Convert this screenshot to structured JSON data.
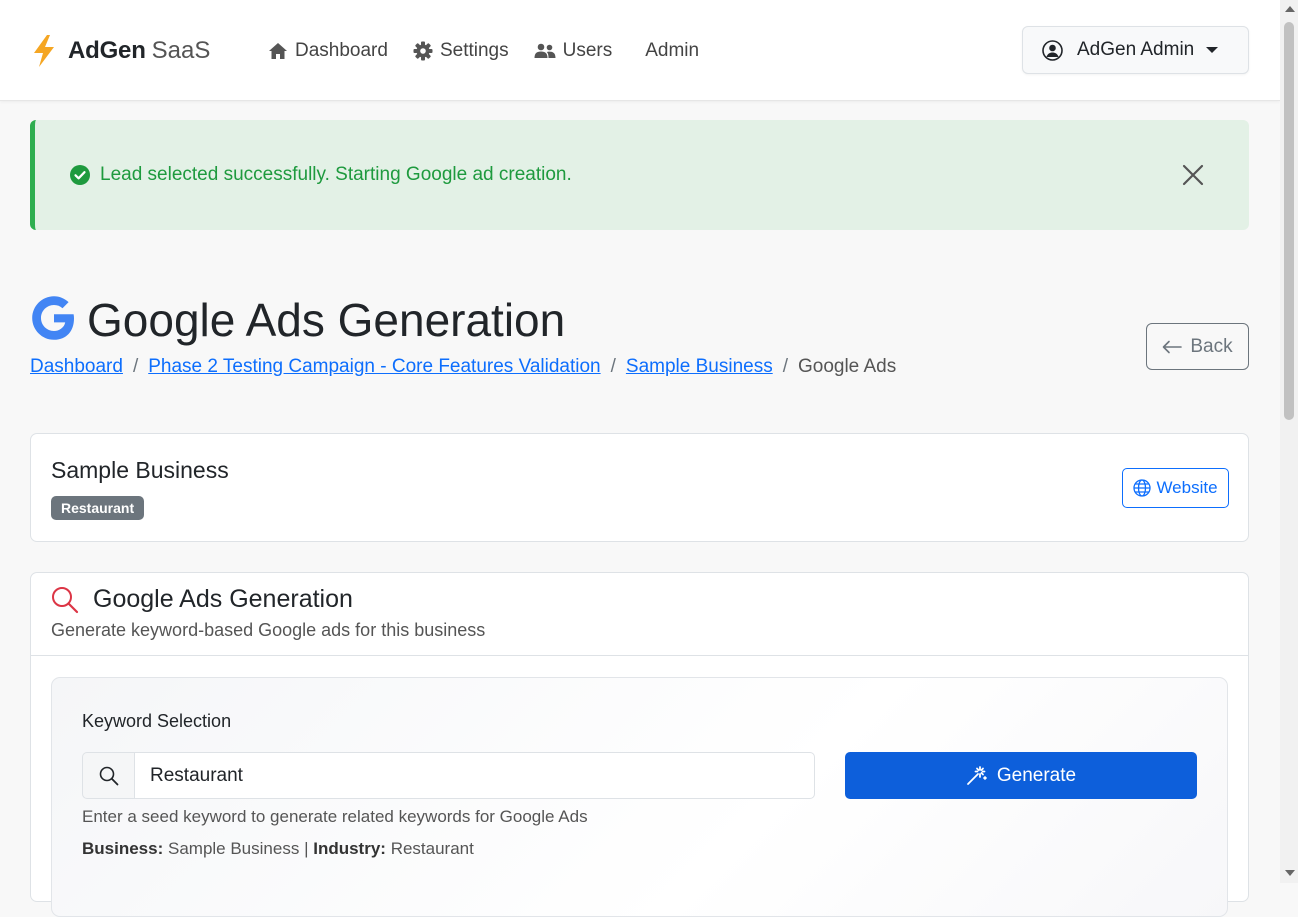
{
  "nav": {
    "brand_name": "AdGen",
    "brand_suffix": "SaaS",
    "items": [
      {
        "label": "Dashboard",
        "icon": "home-icon"
      },
      {
        "label": "Settings",
        "icon": "gear-icon"
      },
      {
        "label": "Users",
        "icon": "users-icon"
      },
      {
        "label": "Admin"
      }
    ],
    "user": "AdGen Admin"
  },
  "alert": {
    "message": "Lead selected successfully. Starting Google ad creation."
  },
  "header": {
    "title": "Google Ads Generation",
    "back_label": "Back",
    "breadcrumb": [
      "Dashboard",
      "Phase 2 Testing Campaign - Core Features Validation",
      "Sample Business",
      "Google Ads"
    ]
  },
  "business": {
    "name": "Sample Business",
    "badge": "Restaurant",
    "website_label": "Website"
  },
  "generation": {
    "title": "Google Ads Generation",
    "subtitle": "Generate keyword-based Google ads for this business",
    "keyword_label": "Keyword Selection",
    "keyword_value": "Restaurant",
    "generate_label": "Generate",
    "hint": "Enter a seed keyword to generate related keywords for Google Ads",
    "business_label": "Business:",
    "business_value": "Sample Business",
    "industry_label": "Industry:",
    "industry_value": "Restaurant"
  },
  "colors": {
    "primary": "#0d6efd",
    "success": "#1e9a3e",
    "alert_bg": "#e3f1e6",
    "badge": "#6c757d"
  }
}
